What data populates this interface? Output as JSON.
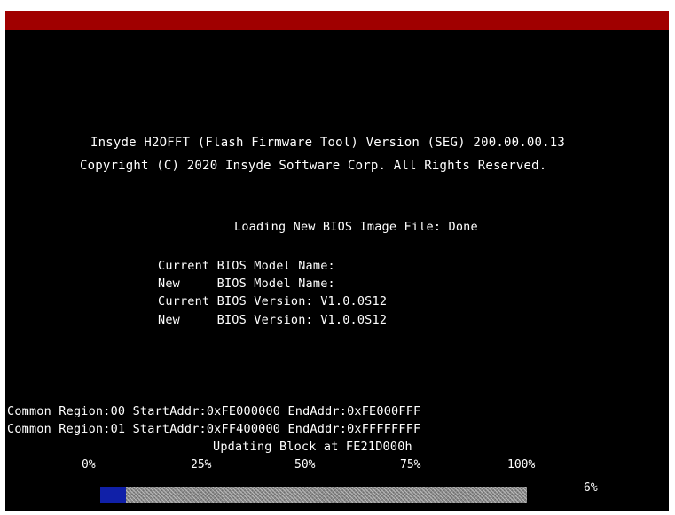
{
  "title_line1": "Insyde H2OFFT (Flash Firmware Tool) Version (SEG) 200.00.00.13",
  "title_line2": "Copyright (C) 2020 Insyde Software Corp. All Rights Reserved.",
  "loading_status": "Loading New BIOS Image File: Done",
  "bios_info": [
    "Current BIOS Model Name:",
    "New     BIOS Model Name:",
    "Current BIOS Version: V1.0.0S12",
    "New     BIOS Version: V1.0.0S12"
  ],
  "regions": [
    "Common Region:00 StartAddr:0xFE000000 EndAddr:0xFE000FFF",
    "Common Region:01 StartAddr:0xFF400000 EndAddr:0xFFFFFFFF"
  ],
  "update_status": "Updating Block at FE21D000h",
  "progress": {
    "scale_labels": [
      "0%",
      "25%",
      "50%",
      "75%",
      "100%"
    ],
    "percent_label": "6%",
    "fraction": 0.06
  },
  "colors": {
    "background": "#000000",
    "top_bar": "#a00000",
    "text": "#ffffff",
    "progress_fill": "#1020a8"
  }
}
